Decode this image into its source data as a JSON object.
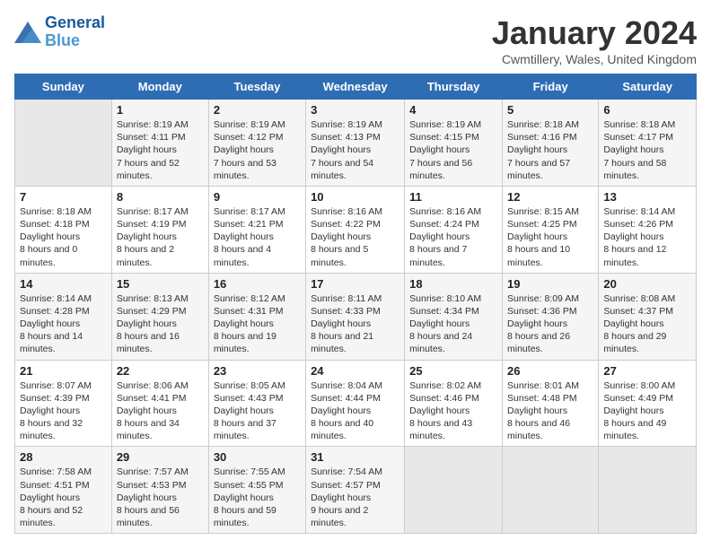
{
  "header": {
    "logo_line1": "General",
    "logo_line2": "Blue",
    "month": "January 2024",
    "location": "Cwmtillery, Wales, United Kingdom"
  },
  "days_of_week": [
    "Sunday",
    "Monday",
    "Tuesday",
    "Wednesday",
    "Thursday",
    "Friday",
    "Saturday"
  ],
  "weeks": [
    [
      {
        "num": "",
        "empty": true
      },
      {
        "num": "1",
        "sunrise": "8:19 AM",
        "sunset": "4:11 PM",
        "daylight": "7 hours and 52 minutes."
      },
      {
        "num": "2",
        "sunrise": "8:19 AM",
        "sunset": "4:12 PM",
        "daylight": "7 hours and 53 minutes."
      },
      {
        "num": "3",
        "sunrise": "8:19 AM",
        "sunset": "4:13 PM",
        "daylight": "7 hours and 54 minutes."
      },
      {
        "num": "4",
        "sunrise": "8:19 AM",
        "sunset": "4:15 PM",
        "daylight": "7 hours and 56 minutes."
      },
      {
        "num": "5",
        "sunrise": "8:18 AM",
        "sunset": "4:16 PM",
        "daylight": "7 hours and 57 minutes."
      },
      {
        "num": "6",
        "sunrise": "8:18 AM",
        "sunset": "4:17 PM",
        "daylight": "7 hours and 58 minutes."
      }
    ],
    [
      {
        "num": "7",
        "sunrise": "8:18 AM",
        "sunset": "4:18 PM",
        "daylight": "8 hours and 0 minutes."
      },
      {
        "num": "8",
        "sunrise": "8:17 AM",
        "sunset": "4:19 PM",
        "daylight": "8 hours and 2 minutes."
      },
      {
        "num": "9",
        "sunrise": "8:17 AM",
        "sunset": "4:21 PM",
        "daylight": "8 hours and 4 minutes."
      },
      {
        "num": "10",
        "sunrise": "8:16 AM",
        "sunset": "4:22 PM",
        "daylight": "8 hours and 5 minutes."
      },
      {
        "num": "11",
        "sunrise": "8:16 AM",
        "sunset": "4:24 PM",
        "daylight": "8 hours and 7 minutes."
      },
      {
        "num": "12",
        "sunrise": "8:15 AM",
        "sunset": "4:25 PM",
        "daylight": "8 hours and 10 minutes."
      },
      {
        "num": "13",
        "sunrise": "8:14 AM",
        "sunset": "4:26 PM",
        "daylight": "8 hours and 12 minutes."
      }
    ],
    [
      {
        "num": "14",
        "sunrise": "8:14 AM",
        "sunset": "4:28 PM",
        "daylight": "8 hours and 14 minutes."
      },
      {
        "num": "15",
        "sunrise": "8:13 AM",
        "sunset": "4:29 PM",
        "daylight": "8 hours and 16 minutes."
      },
      {
        "num": "16",
        "sunrise": "8:12 AM",
        "sunset": "4:31 PM",
        "daylight": "8 hours and 19 minutes."
      },
      {
        "num": "17",
        "sunrise": "8:11 AM",
        "sunset": "4:33 PM",
        "daylight": "8 hours and 21 minutes."
      },
      {
        "num": "18",
        "sunrise": "8:10 AM",
        "sunset": "4:34 PM",
        "daylight": "8 hours and 24 minutes."
      },
      {
        "num": "19",
        "sunrise": "8:09 AM",
        "sunset": "4:36 PM",
        "daylight": "8 hours and 26 minutes."
      },
      {
        "num": "20",
        "sunrise": "8:08 AM",
        "sunset": "4:37 PM",
        "daylight": "8 hours and 29 minutes."
      }
    ],
    [
      {
        "num": "21",
        "sunrise": "8:07 AM",
        "sunset": "4:39 PM",
        "daylight": "8 hours and 32 minutes."
      },
      {
        "num": "22",
        "sunrise": "8:06 AM",
        "sunset": "4:41 PM",
        "daylight": "8 hours and 34 minutes."
      },
      {
        "num": "23",
        "sunrise": "8:05 AM",
        "sunset": "4:43 PM",
        "daylight": "8 hours and 37 minutes."
      },
      {
        "num": "24",
        "sunrise": "8:04 AM",
        "sunset": "4:44 PM",
        "daylight": "8 hours and 40 minutes."
      },
      {
        "num": "25",
        "sunrise": "8:02 AM",
        "sunset": "4:46 PM",
        "daylight": "8 hours and 43 minutes."
      },
      {
        "num": "26",
        "sunrise": "8:01 AM",
        "sunset": "4:48 PM",
        "daylight": "8 hours and 46 minutes."
      },
      {
        "num": "27",
        "sunrise": "8:00 AM",
        "sunset": "4:49 PM",
        "daylight": "8 hours and 49 minutes."
      }
    ],
    [
      {
        "num": "28",
        "sunrise": "7:58 AM",
        "sunset": "4:51 PM",
        "daylight": "8 hours and 52 minutes."
      },
      {
        "num": "29",
        "sunrise": "7:57 AM",
        "sunset": "4:53 PM",
        "daylight": "8 hours and 56 minutes."
      },
      {
        "num": "30",
        "sunrise": "7:55 AM",
        "sunset": "4:55 PM",
        "daylight": "8 hours and 59 minutes."
      },
      {
        "num": "31",
        "sunrise": "7:54 AM",
        "sunset": "4:57 PM",
        "daylight": "9 hours and 2 minutes."
      },
      {
        "num": "",
        "empty": true
      },
      {
        "num": "",
        "empty": true
      },
      {
        "num": "",
        "empty": true
      }
    ]
  ]
}
